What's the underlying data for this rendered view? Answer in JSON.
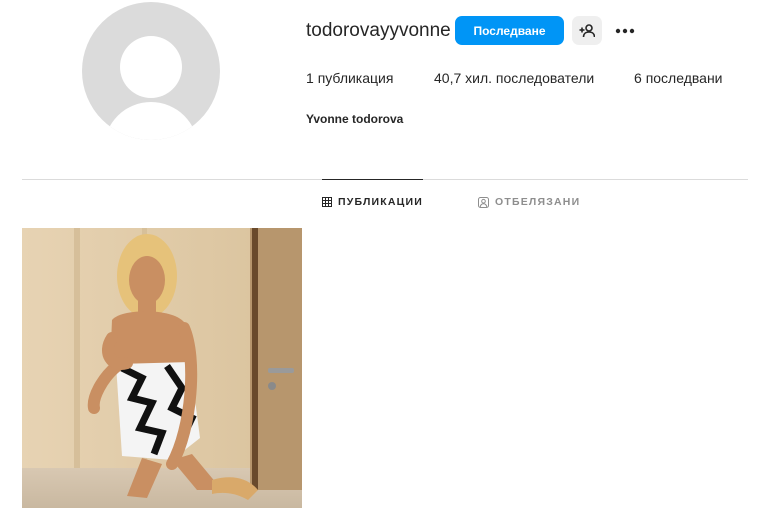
{
  "profile": {
    "username": "todorovayyvonne",
    "full_name": "Yvonne todorova",
    "follow_label": "Последване",
    "suggest_icon": "add-person-icon",
    "more_icon": "more-options-icon"
  },
  "stats": {
    "posts": "1",
    "posts_label": "публикация",
    "followers": "40,7 хил.",
    "followers_label": "последователи",
    "following": "6",
    "following_label": "последвани"
  },
  "tabs": [
    {
      "label": "ПУБЛИКАЦИИ",
      "icon": "grid-icon",
      "active": true
    },
    {
      "label": "ОТБЕЛЯЗАНИ",
      "icon": "tagged-icon",
      "active": false
    }
  ],
  "colors": {
    "accent": "#0095f6",
    "text": "#262626",
    "muted": "#8e8e8e",
    "border": "#dbdbdb"
  }
}
